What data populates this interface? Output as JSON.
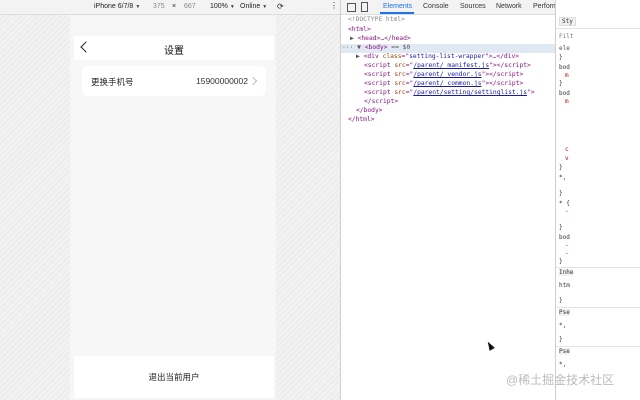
{
  "device_toolbar": {
    "device": "iPhone 6/7/8",
    "width": "375",
    "times": "×",
    "height": "667",
    "zoom": "100%",
    "network": "Online"
  },
  "phone": {
    "nav_title": "设置",
    "row_label": "更换手机号",
    "row_value": "15900000002",
    "logout_label": "退出当前用户"
  },
  "devtools": {
    "tabs": [
      "Elements",
      "Console",
      "Sources",
      "Network",
      "Performance"
    ],
    "active_tab": "Elements",
    "dom": {
      "doctype": "<!DOCTYPE html>",
      "html_open": "<html>",
      "head": "<head>…</head>",
      "body_open": "<body>",
      "body_selected": "== $0",
      "div_class": "setting-list-wrapper",
      "scripts": [
        "/parent/_manifest.js",
        "/parent/_vendor.js",
        "/parent/_common.js",
        "/parent/setting/settinglist.js"
      ],
      "body_close": "</body>",
      "html_close": "</html>"
    }
  },
  "styles_panel": {
    "tab": "Sty",
    "filter": "Filt",
    "element": "ele",
    "lines": [
      "}",
      "bod",
      "m",
      "}",
      "bod",
      "m",
      "c",
      "v",
      "}",
      "*,",
      "}",
      "* {",
      "-",
      "}",
      "bod",
      "-",
      "-",
      "}",
      "Inhe",
      "htm",
      "}",
      "Pse",
      "*,",
      "}",
      "Pse",
      "*,"
    ]
  },
  "watermark": "@稀土掘金技术社区"
}
